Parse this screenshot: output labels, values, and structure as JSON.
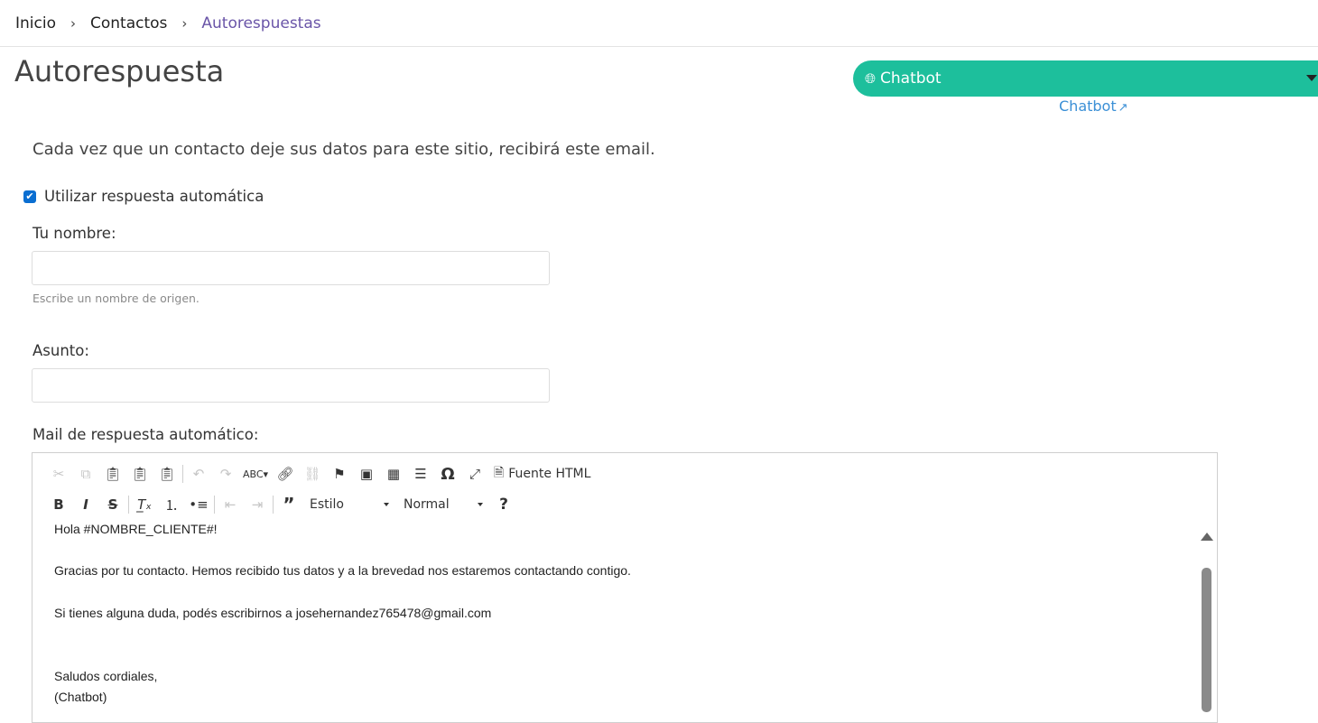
{
  "breadcrumb": {
    "home": "Inicio",
    "contacts": "Contactos",
    "current": "Autorespuestas",
    "separator": "›"
  },
  "page_title": "Autorespuesta",
  "site_selector": {
    "label": "Chatbot",
    "globe_icon": "globe-icon",
    "link": "Chatbot",
    "link_icon": "external-link-icon",
    "color": "#1dbf9c"
  },
  "intro": "Cada vez que un contacto deje sus datos para este sitio, recibirá este email.",
  "auto_reply": {
    "label": "Utilizar respuesta automática",
    "checked": true
  },
  "name_field": {
    "label": "Tu nombre:",
    "value": "",
    "help": "Escribe un nombre de origen."
  },
  "subject_field": {
    "label": "Asunto:",
    "value": ""
  },
  "mail_label": "Mail de respuesta automático:",
  "toolbar": {
    "row1_icons": [
      "cut-icon",
      "copy-icon",
      "paste-icon",
      "paste-text-icon",
      "paste-word-icon",
      "undo-icon",
      "redo-icon",
      "spellcheck-icon",
      "link-icon",
      "unlink-icon",
      "anchor-icon",
      "image-icon",
      "table-icon",
      "horizontal-line-icon",
      "special-char-icon",
      "maximize-icon",
      "source-icon"
    ],
    "source_label": "Fuente HTML",
    "style_combo": "Estilo",
    "format_combo": "Normal",
    "help_label": "?"
  },
  "editor_content": {
    "greeting": "Hola #NOMBRE_CLIENTE#!",
    "line1": "Gracias por tu contacto. Hemos recibido tus datos y a la brevedad nos estaremos contactando contigo.",
    "line2": "Si tienes alguna duda, podés escribirnos a josehernandez765478@gmail.com",
    "closing": "Saludos cordiales,",
    "signature": "(Chatbot)"
  }
}
